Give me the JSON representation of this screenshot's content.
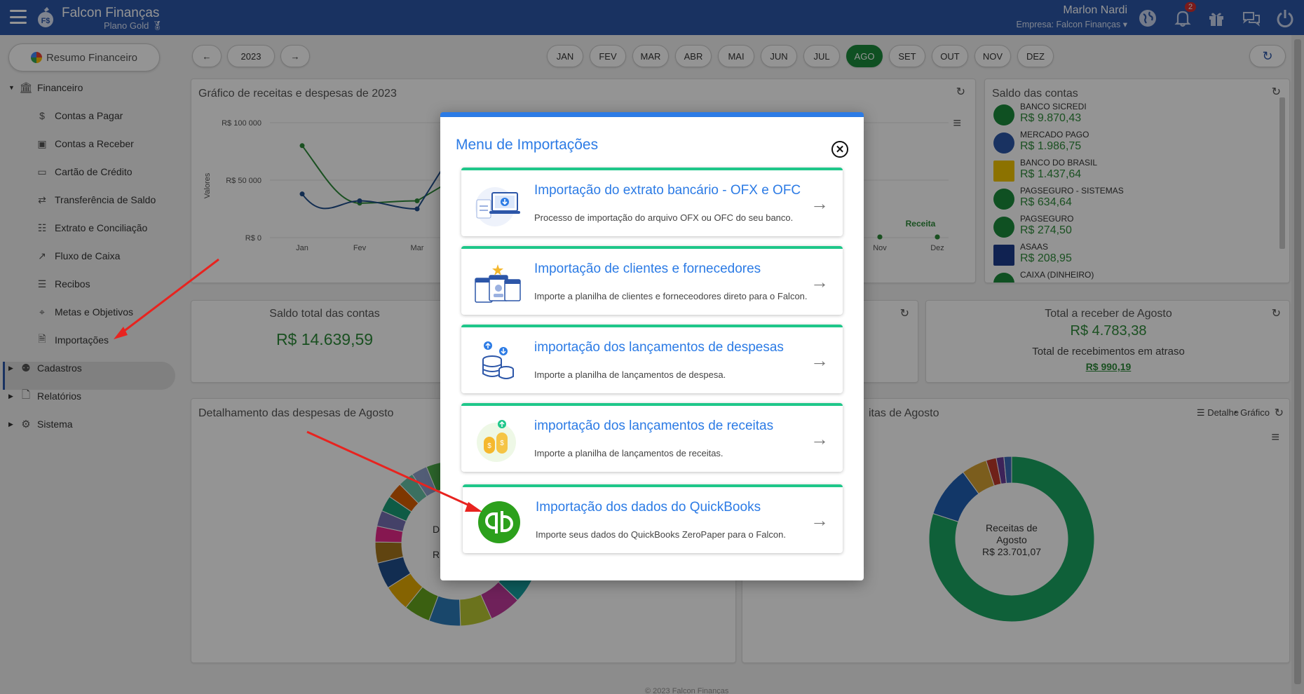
{
  "app": {
    "brand": "Falcon Finanças",
    "plan": "Plano Gold"
  },
  "user": {
    "name": "Marlon Nardi",
    "company": "Empresa: Falcon Finanças",
    "notifications": "2"
  },
  "sidebar": {
    "resumo": "Resumo Financeiro",
    "financeiro": "Financeiro",
    "items": [
      "Contas a Pagar",
      "Contas a Receber",
      "Cartão de Crédito",
      "Transferência de Saldo",
      "Extrato e Conciliação",
      "Fluxo de Caixa",
      "Recibos",
      "Metas e Objetivos",
      "Importações"
    ],
    "cadastros": "Cadastros",
    "relatorios": "Relatórios",
    "sistema": "Sistema"
  },
  "period": {
    "year": "2023",
    "months": [
      "JAN",
      "FEV",
      "MAR",
      "ABR",
      "MAI",
      "JUN",
      "JUL",
      "AGO",
      "SET",
      "OUT",
      "NOV",
      "DEZ"
    ],
    "selected": "AGO"
  },
  "chart_card": {
    "title": "Gráfico de receitas e despesas de 2023"
  },
  "chart_data": {
    "type": "line",
    "ylabel": "Valores",
    "yticks": [
      "R$ 100 000",
      "R$ 50 000",
      "R$ 0"
    ],
    "x": [
      "Jan",
      "Fev",
      "Mar",
      "Nov",
      "Dez"
    ],
    "series": [
      {
        "name": "Receita",
        "values": [
          80000,
          30000,
          32000,
          0,
          0
        ],
        "color": "#2e8b3a"
      },
      {
        "values": [
          38000,
          32000,
          25000,
          0,
          0
        ],
        "color": "#1f4e8c"
      }
    ]
  },
  "accounts": {
    "title": "Saldo das contas",
    "items": [
      {
        "name": "BANCO SICREDI",
        "value": "R$ 9.870,43"
      },
      {
        "name": "MERCADO PAGO",
        "value": "R$ 1.986,75"
      },
      {
        "name": "BANCO DO BRASIL",
        "value": "R$ 1.437,64"
      },
      {
        "name": "PAGSEGURO - SISTEMAS",
        "value": "R$ 634,64"
      },
      {
        "name": "PAGSEGURO",
        "value": "R$ 274,50"
      },
      {
        "name": "ASAAS",
        "value": "R$ 208,95"
      },
      {
        "name": "CAIXA (DINHEIRO)"
      }
    ]
  },
  "saldo_total": {
    "title": "Saldo total das contas",
    "value": "R$ 14.639,59"
  },
  "receber": {
    "title": "Total a receber de Agosto",
    "value": "R$ 4.783,38",
    "late_label": "Total de recebimentos em atraso",
    "late_value": "R$ 990,19"
  },
  "despesas_card": {
    "title": "Detalhamento das despesas de Agosto",
    "center_partial_1": "D",
    "center_partial_2": "R"
  },
  "receitas_card": {
    "title_partial": "itas de Agosto",
    "detalhe": "Detalhe",
    "grafico": "Gráfico",
    "center_line1": "Receitas de",
    "center_line2": "Agosto",
    "center_value": "R$ 23.701,07"
  },
  "modal": {
    "title": "Menu de Importações",
    "items": [
      {
        "title": "Importação do extrato bancário - OFX e OFC",
        "desc": "Processo de importação do arquivo OFX ou OFC do seu banco."
      },
      {
        "title": "Importação de clientes e fornecedores",
        "desc": "Importe a planilha de clientes e forneceodores direto para o Falcon."
      },
      {
        "title": "importação dos lançamentos de despesas",
        "desc": "Importe a planilha de lançamentos de despesa."
      },
      {
        "title": "importação dos lançamentos de receitas",
        "desc": "Importe a planilha de lançamentos de receitas."
      },
      {
        "title": "Importação dos dados do QuickBooks",
        "desc": "Importe seus dados do QuickBooks ZeroPaper para o Falcon."
      }
    ]
  },
  "footer": {
    "text": "© 2023 Falcon Finanças"
  }
}
